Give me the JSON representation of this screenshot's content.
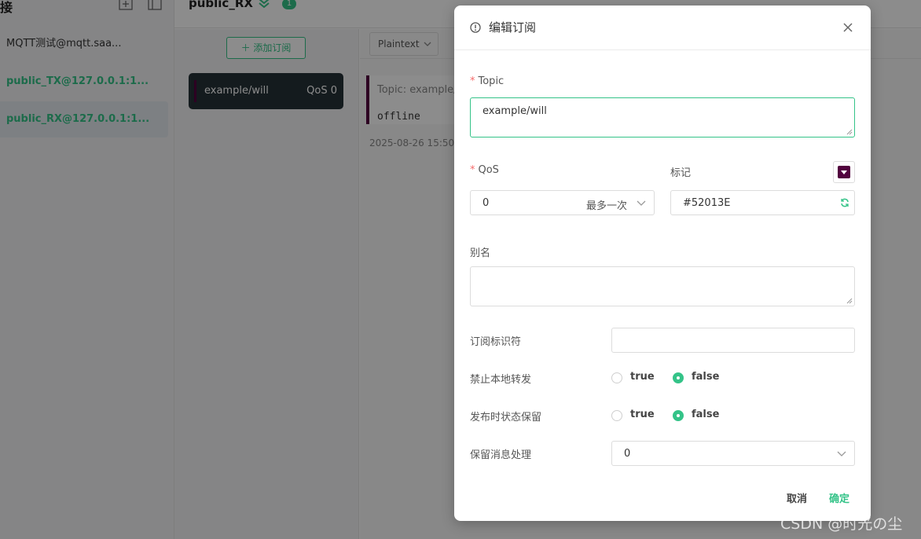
{
  "colors": {
    "accent": "#34c388",
    "mark": "#52013E",
    "dark_card": "#263238"
  },
  "sidebar": {
    "title": "接",
    "connections": [
      {
        "label": "MQTT测试@mqtt.saa...",
        "state": "plain"
      },
      {
        "label": "public_TX@127.0.0.1:1...",
        "state": "green"
      },
      {
        "label": "public_RX@127.0.0.1:1...",
        "state": "green-active"
      }
    ]
  },
  "header": {
    "connection_name": "public_RX",
    "badge_count": "1"
  },
  "subscriptions": {
    "add_label": "添加订阅",
    "items": [
      {
        "topic": "example/will",
        "qos": "QoS 0"
      }
    ]
  },
  "messages": {
    "format": "Plaintext",
    "items": [
      {
        "topic": "Topic: example/",
        "payload": "offline",
        "time": "2025-08-26 15:50"
      }
    ]
  },
  "dialog": {
    "title": "编辑订阅",
    "topic_label": "Topic",
    "topic_value": "example/will",
    "qos_label": "QoS",
    "qos_value": "0",
    "qos_hint": "最多一次",
    "mark_label": "标记",
    "mark_color": "#52013E",
    "alias_label": "别名",
    "alias_value": "",
    "sub_id_label": "订阅标识符",
    "sub_id_value": "",
    "no_local_label": "禁止本地转发",
    "no_local_options": [
      "true",
      "false"
    ],
    "no_local_selected": "false",
    "retain_as_published_label": "发布时状态保留",
    "retain_as_published_options": [
      "true",
      "false"
    ],
    "retain_as_published_selected": "false",
    "retain_handling_label": "保留消息处理",
    "retain_handling_value": "0",
    "cancel_label": "取消",
    "confirm_label": "确定"
  },
  "watermark": "CSDN @时光の尘"
}
